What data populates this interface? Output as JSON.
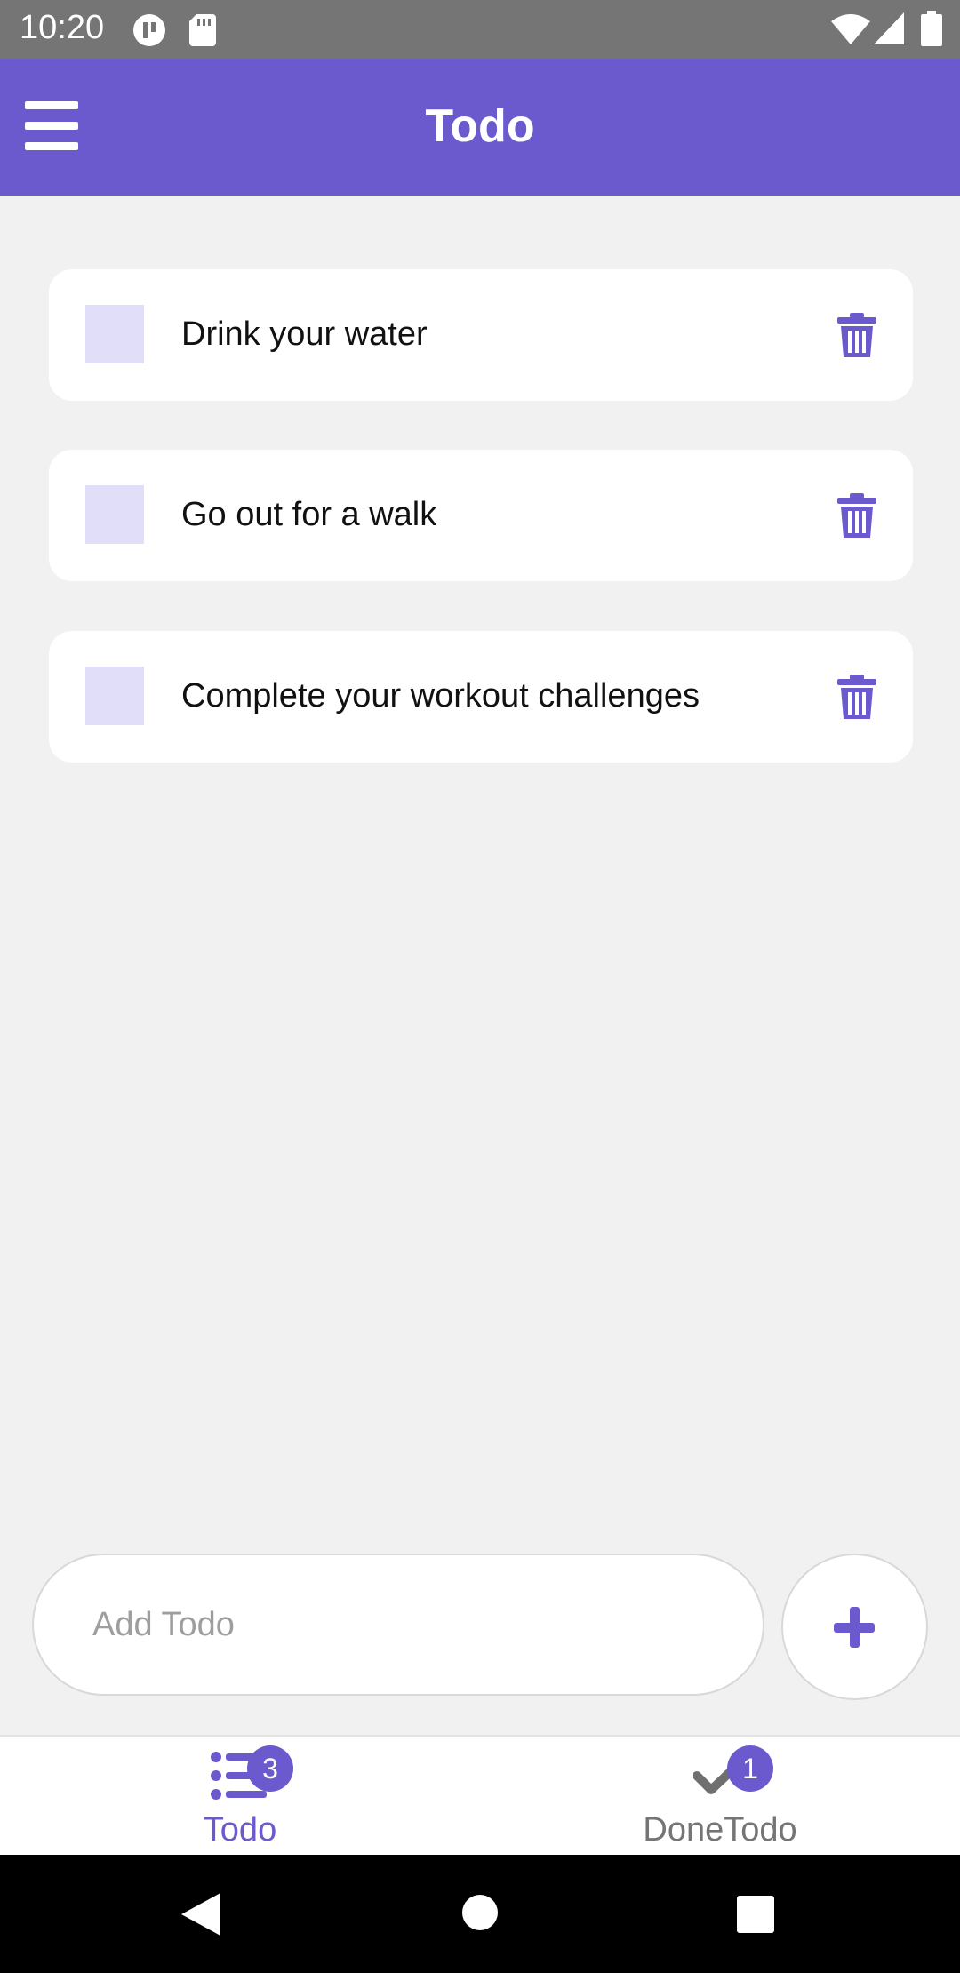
{
  "status_bar": {
    "time": "10:20"
  },
  "app_bar": {
    "title": "Todo"
  },
  "todos": [
    {
      "text": "Drink your water",
      "done": false
    },
    {
      "text": "Go out for a walk",
      "done": false
    },
    {
      "text": "Complete your workout challenges",
      "done": false
    }
  ],
  "add_todo": {
    "placeholder": "Add Todo",
    "value": ""
  },
  "tabs": [
    {
      "label": "Todo",
      "badge": "3",
      "active": true,
      "icon": "list-icon"
    },
    {
      "label": "DoneTodo",
      "badge": "1",
      "active": false,
      "icon": "check-icon"
    }
  ],
  "colors": {
    "accent": "#6a5acd",
    "status_bar": "#757575",
    "background": "#f1f1f1",
    "inactive": "#757575",
    "checkbox": "#e1defa"
  }
}
